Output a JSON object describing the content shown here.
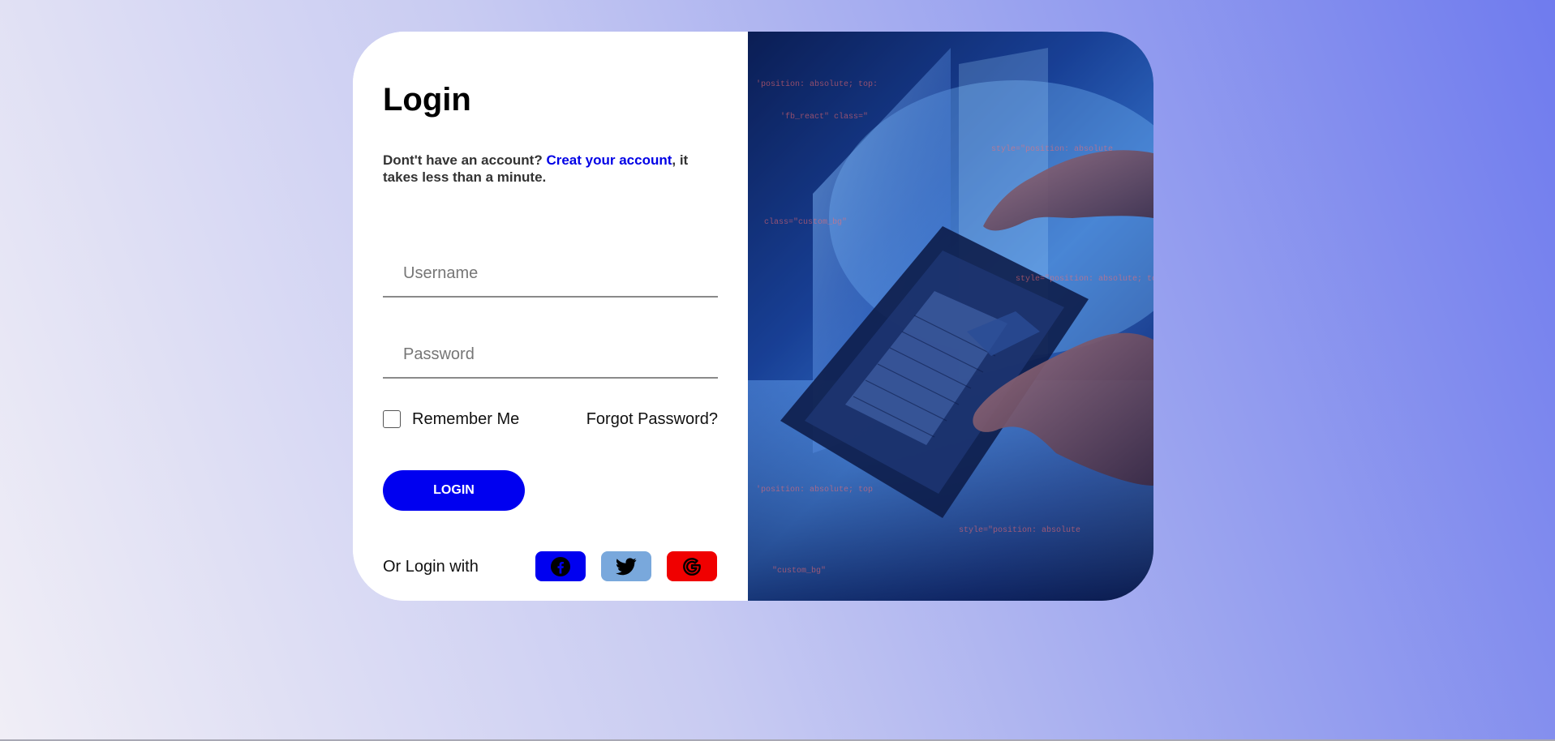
{
  "login": {
    "title": "Login",
    "subtitle_prefix": "Dont't have an account? ",
    "create_account_link": "Creat your account",
    "subtitle_suffix": ", it takes less than a minute.",
    "username_placeholder": "Username",
    "password_placeholder": "Password",
    "remember_me": "Remember Me",
    "forgot_password": "Forgot Password?",
    "login_button": "LOGIN",
    "or_login_with": "Or Login with"
  },
  "social": [
    {
      "name": "facebook",
      "icon": "facebook-icon",
      "color": "#0000f0"
    },
    {
      "name": "twitter",
      "icon": "twitter-icon",
      "color": "#79a8dc"
    },
    {
      "name": "google",
      "icon": "google-icon",
      "color": "#f00000"
    }
  ],
  "colors": {
    "accent": "#0000f0",
    "link": "#0000e6"
  },
  "image": {
    "icon": "laptop-coding-photo"
  }
}
